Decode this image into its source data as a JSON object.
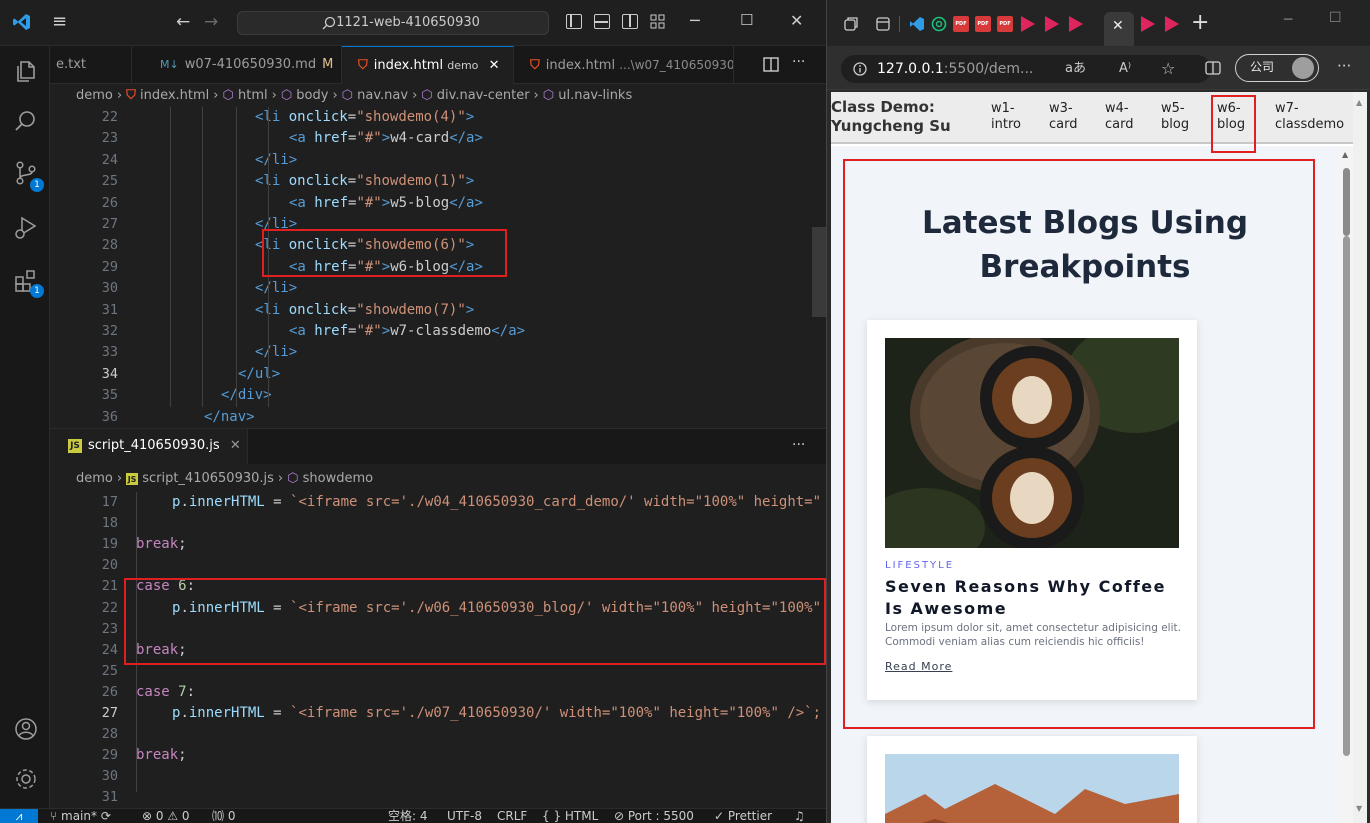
{
  "vscode": {
    "command_center": "1121-web-410650930",
    "tabs": [
      {
        "label": "e.txt"
      },
      {
        "label": "w07-410650930.md",
        "badge": "M",
        "icon_text": "M↓"
      },
      {
        "label": "index.html",
        "suffix": "demo",
        "close": "✕"
      },
      {
        "label": "index.html",
        "suffix": "...\\w07_410650930"
      }
    ],
    "html_breadcrumb": [
      "demo",
      "index.html",
      "html",
      "body",
      "nav.nav",
      "div.nav-center",
      "ul.nav-links"
    ],
    "html_lines": [
      {
        "n": "22",
        "code": "<li onclick=\"showdemo(4)\">"
      },
      {
        "n": "23",
        "code": "<a href=\"#\">w4-card</a>"
      },
      {
        "n": "24",
        "code": "</li>"
      },
      {
        "n": "25",
        "code": "<li onclick=\"showdemo(1)\">"
      },
      {
        "n": "26",
        "code": "<a href=\"#\">w5-blog</a>"
      },
      {
        "n": "27",
        "code": "</li>"
      },
      {
        "n": "28",
        "code": "<li onclick=\"showdemo(6)\">"
      },
      {
        "n": "29",
        "code": "<a href=\"#\">w6-blog</a>"
      },
      {
        "n": "30",
        "code": "</li>"
      },
      {
        "n": "31",
        "code": "<li onclick=\"showdemo(7)\">"
      },
      {
        "n": "32",
        "code": "<a href=\"#\">w7-classdemo</a>"
      },
      {
        "n": "33",
        "code": "</li>"
      },
      {
        "n": "34",
        "code": "</ul>"
      },
      {
        "n": "35",
        "code": "</div>"
      },
      {
        "n": "36",
        "code": "</nav>"
      }
    ],
    "js_tab": {
      "label": "script_410650930.js",
      "icon_text": "JS",
      "close": "✕",
      "more": "···"
    },
    "js_breadcrumb": [
      "demo",
      "script_410650930.js",
      "showdemo"
    ],
    "js_lines": [
      {
        "n": "17",
        "code": "p.innerHTML = `<iframe src='./w04_410650930_card_demo/' width=\"100%\" height=\""
      },
      {
        "n": "18",
        "code": ""
      },
      {
        "n": "19",
        "code": "break;"
      },
      {
        "n": "20",
        "code": ""
      },
      {
        "n": "21",
        "code": "case 6:"
      },
      {
        "n": "22",
        "code": "p.innerHTML = `<iframe src='./w06_410650930_blog/' width=\"100%\" height=\"100%\""
      },
      {
        "n": "23",
        "code": ""
      },
      {
        "n": "24",
        "code": "break;"
      },
      {
        "n": "25",
        "code": ""
      },
      {
        "n": "26",
        "code": "case 7:"
      },
      {
        "n": "27",
        "code": "p.innerHTML = `<iframe src='./w07_410650930/' width=\"100%\" height=\"100%\" />`;"
      },
      {
        "n": "28",
        "code": ""
      },
      {
        "n": "29",
        "code": "break;"
      },
      {
        "n": "30",
        "code": ""
      },
      {
        "n": "31",
        "code": ""
      }
    ],
    "status": {
      "branch": "main*",
      "problems": "⊗ 0 ⚠ 0",
      "ports": "⑽ 0",
      "spaces": "空格: 4",
      "encoding": "UTF-8",
      "eol": "CRLF",
      "language": "{ } HTML",
      "port": "⊘ Port : 5500",
      "prettier": "✓ Prettier"
    },
    "activity_badges": {
      "scm": "1",
      "extensions": "1"
    }
  },
  "browser": {
    "address_host": "127.0.0.1",
    "address_path": ":5500/dem...",
    "read_aloud": "aあ",
    "profile_label": "公司",
    "more": "···",
    "site": {
      "title": "Class Demo:\nYungcheng Su",
      "nav": [
        "w1-\nintro",
        "w3-\ncard",
        "w4-\ncard",
        "w5-\nblog",
        "w6-\nblog",
        "w7-\nclassdemo"
      ]
    },
    "blog": {
      "heading": "Latest Blogs Using Breakpoints",
      "card": {
        "category": "LIFESTYLE",
        "title": "Seven Reasons Why Coffee Is Awesome",
        "description": "Lorem ipsum dolor sit, amet consectetur adipisicing elit. Commodi veniam alias cum reiciendis hic officiis!",
        "link": "Read More"
      }
    }
  },
  "colors": {
    "highlight_box": "#e02020",
    "vscode_accent": "#0078d4",
    "blog_accent": "#6366f1"
  }
}
